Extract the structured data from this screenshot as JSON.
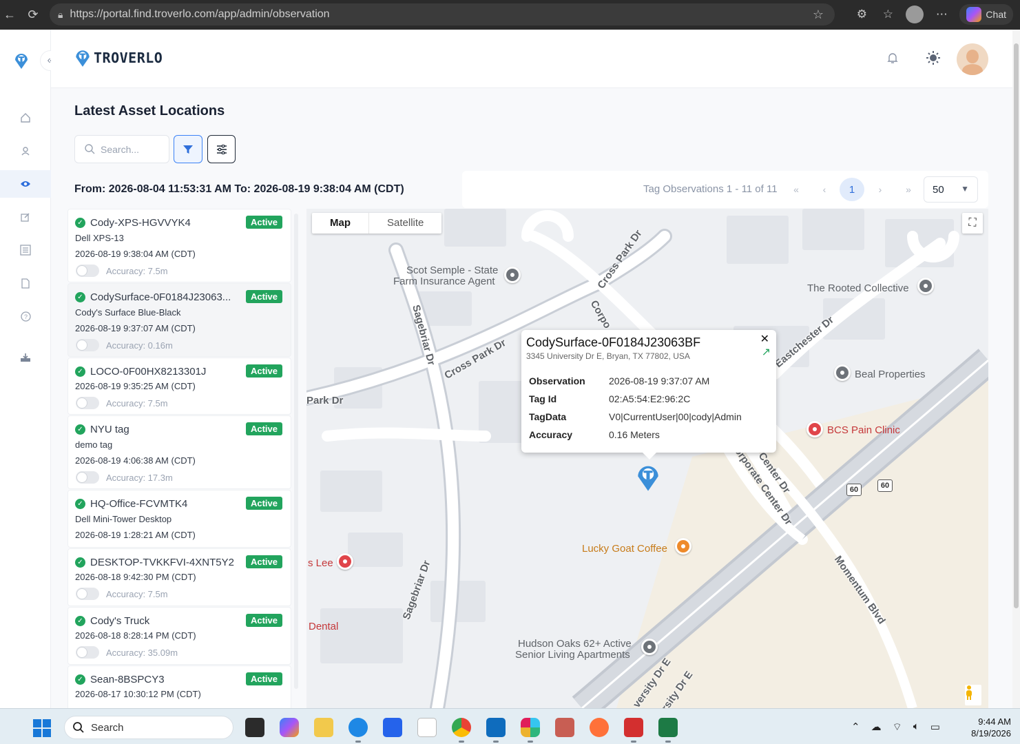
{
  "browser": {
    "url": "https://portal.find.troverlo.com/app/admin/observation",
    "url_host": "portal.find.troverlo.com",
    "chat_label": "Chat"
  },
  "brand": {
    "name": "TROVERLO",
    "color": "#3b8fd9"
  },
  "sidebar": {
    "items": [
      {
        "icon": "home-icon"
      },
      {
        "icon": "user-icon"
      },
      {
        "icon": "eye-icon",
        "active": true
      },
      {
        "icon": "edit-icon"
      },
      {
        "icon": "list-icon"
      },
      {
        "icon": "document-icon"
      },
      {
        "icon": "help-icon"
      },
      {
        "icon": "download-icon"
      }
    ]
  },
  "page": {
    "title": "Latest Asset Locations",
    "search_placeholder": "Search...",
    "date_range": "From: 2026-08-04 11:53:31 AM  To: 2026-08-19 9:38:04 AM (CDT)"
  },
  "pagination": {
    "summary": "Tag Observations 1 - 11 of 11",
    "current_page": "1",
    "page_size": "50",
    "first": "«",
    "prev": "‹",
    "next": "›",
    "last": "»"
  },
  "assets": [
    {
      "name": "Cody-XPS-HGVVYK4",
      "status": "Active",
      "subtitle": "Dell XPS-13",
      "time": "2026-08-19 9:38:04 AM (CDT)",
      "accuracy": "Accuracy: 7.5m"
    },
    {
      "name": "CodySurface-0F0184J23063...",
      "status": "Active",
      "subtitle": "Cody's Surface Blue-Black",
      "time": "2026-08-19 9:37:07 AM (CDT)",
      "accuracy": "Accuracy: 0.16m",
      "selected": true
    },
    {
      "name": "LOCO-0F00HX8213301J",
      "status": "Active",
      "subtitle": "",
      "time": "2026-08-19 9:35:25 AM (CDT)",
      "accuracy": "Accuracy: 7.5m"
    },
    {
      "name": "NYU tag",
      "status": "Active",
      "subtitle": "demo tag",
      "time": "2026-08-19 4:06:38 AM (CDT)",
      "accuracy": "Accuracy: 17.3m"
    },
    {
      "name": "HQ-Office-FCVMTK4",
      "status": "Active",
      "subtitle": "Dell Mini-Tower Desktop",
      "time": "2026-08-19 1:28:21 AM (CDT)",
      "accuracy": ""
    },
    {
      "name": "DESKTOP-TVKKFVI-4XNT5Y2",
      "status": "Active",
      "subtitle": "",
      "time": "2026-08-18 9:42:30 PM (CDT)",
      "accuracy": "Accuracy: 7.5m"
    },
    {
      "name": "Cody's Truck",
      "status": "Active",
      "subtitle": "",
      "time": "2026-08-18 8:28:14 PM (CDT)",
      "accuracy": "Accuracy: 35.09m"
    },
    {
      "name": "Sean-8BSPCY3",
      "status": "Active",
      "subtitle": "",
      "time": "2026-08-17 10:30:12 PM (CDT)",
      "accuracy": ""
    }
  ],
  "map": {
    "type_map": "Map",
    "type_satellite": "Satellite",
    "labels": {
      "scot_1": "Scot Semple - State",
      "scot_2": "Farm Insurance Agent",
      "rooted": "The Rooted Collective",
      "beal": "Beal Properties",
      "bcs": "BCS Pain Clinic",
      "lucky": "Lucky Goat Coffee",
      "hudson_1": "Hudson Oaks 62+ Active",
      "hudson_2": "Senior Living Apartments",
      "lee": "s Lee",
      "dental": "Dental"
    },
    "roads": {
      "cross_park_1": "Cross Park Dr",
      "cross_park_2": "Cross Park Dr",
      "park": "Park Dr",
      "sagebriar_1": "Sagebriar Dr",
      "sagebriar_2": "Sagebriar Dr",
      "corpo": "Corpo",
      "eastchester": "Eastchester Dr",
      "corp_center_1": "Corporate Center Dr",
      "corp_center_2": "Center Dr",
      "momentum": "Momentum Blvd",
      "university_1": "versity Dr E",
      "university_2": "rsity Dr E"
    },
    "shields": [
      "60",
      "60"
    ],
    "popup": {
      "title": "CodySurface-0F0184J23063BF",
      "address": "3345 University Dr E, Bryan, TX 77802, USA",
      "rows": [
        {
          "key": "Observation",
          "value": "2026-08-19 9:37:07 AM"
        },
        {
          "key": "Tag Id",
          "value": "02:A5:54:E2:96:2C"
        },
        {
          "key": "TagData",
          "value": "V0|CurrentUser|00|cody|Admin"
        },
        {
          "key": "Accuracy",
          "value": "0.16 Meters"
        }
      ]
    }
  },
  "taskbar": {
    "search_label": "Search",
    "time": "9:44 AM",
    "date": "8/19/2026"
  }
}
